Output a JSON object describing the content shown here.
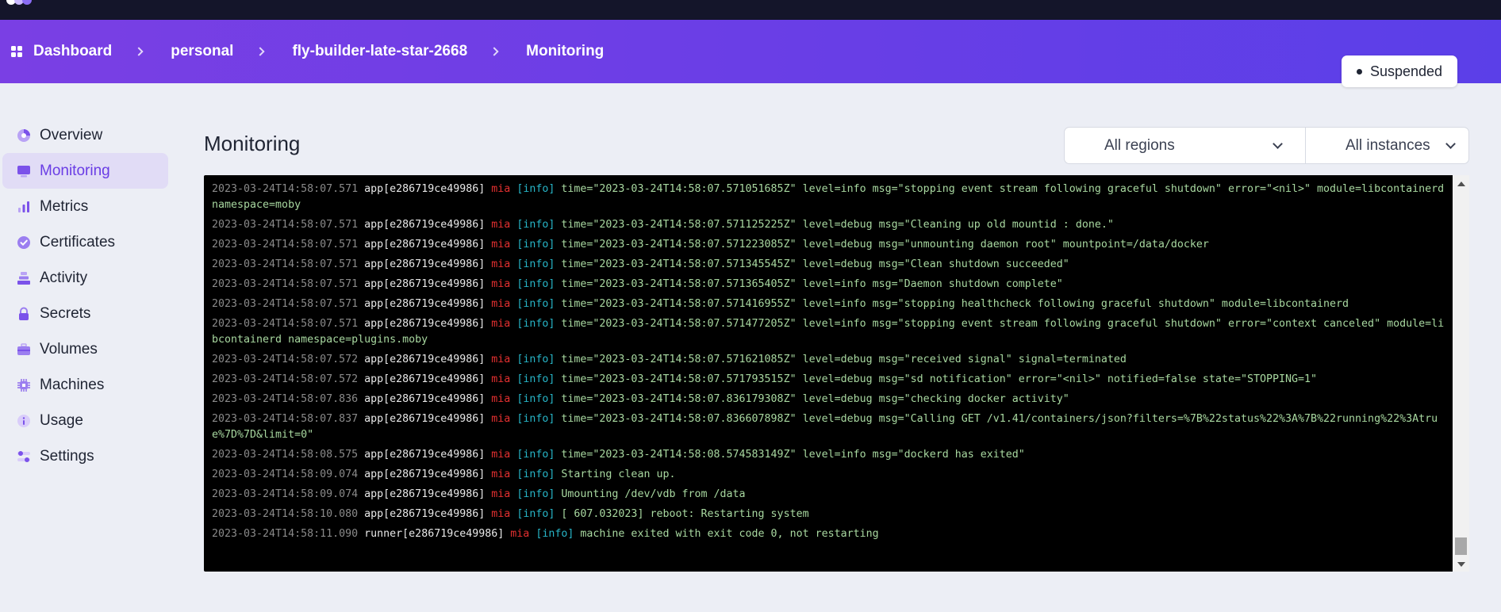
{
  "header": {
    "breadcrumbs": [
      "Dashboard",
      "personal",
      "fly-builder-late-star-2668",
      "Monitoring"
    ],
    "status_badge": "Suspended"
  },
  "sidebar": {
    "items": [
      {
        "label": "Overview",
        "icon": "gauge-icon"
      },
      {
        "label": "Monitoring",
        "icon": "monitor-icon",
        "active": true
      },
      {
        "label": "Metrics",
        "icon": "bar-chart-icon"
      },
      {
        "label": "Certificates",
        "icon": "badge-check-icon"
      },
      {
        "label": "Activity",
        "icon": "stack-icon"
      },
      {
        "label": "Secrets",
        "icon": "lock-icon"
      },
      {
        "label": "Volumes",
        "icon": "briefcase-icon"
      },
      {
        "label": "Machines",
        "icon": "chip-icon"
      },
      {
        "label": "Usage",
        "icon": "info-icon"
      },
      {
        "label": "Settings",
        "icon": "settings-icon"
      }
    ]
  },
  "main": {
    "title": "Monitoring",
    "region_filter": "All regions",
    "instance_filter": "All instances"
  },
  "colors": {
    "accent": "#6a3de5",
    "log_bg": "#000000",
    "region_red": "#e43030",
    "level_cyan": "#27b5c7",
    "message_green": "#a8d8a0"
  },
  "logs": [
    {
      "ts": "2023-03-24T14:58:07.571",
      "src": "app[e286719ce49986]",
      "region": "mia",
      "level": "[info]",
      "msg": "time=\"2023-03-24T14:58:07.571051685Z\" level=info msg=\"stopping event stream following graceful shutdown\" error=\"<nil>\" module=libcontainerd namespace=moby"
    },
    {
      "ts": "2023-03-24T14:58:07.571",
      "src": "app[e286719ce49986]",
      "region": "mia",
      "level": "[info]",
      "msg": "time=\"2023-03-24T14:58:07.571125225Z\" level=debug msg=\"Cleaning up old mountid : done.\""
    },
    {
      "ts": "2023-03-24T14:58:07.571",
      "src": "app[e286719ce49986]",
      "region": "mia",
      "level": "[info]",
      "msg": "time=\"2023-03-24T14:58:07.571223085Z\" level=debug msg=\"unmounting daemon root\" mountpoint=/data/docker"
    },
    {
      "ts": "2023-03-24T14:58:07.571",
      "src": "app[e286719ce49986]",
      "region": "mia",
      "level": "[info]",
      "msg": "time=\"2023-03-24T14:58:07.571345545Z\" level=debug msg=\"Clean shutdown succeeded\""
    },
    {
      "ts": "2023-03-24T14:58:07.571",
      "src": "app[e286719ce49986]",
      "region": "mia",
      "level": "[info]",
      "msg": "time=\"2023-03-24T14:58:07.571365405Z\" level=info msg=\"Daemon shutdown complete\""
    },
    {
      "ts": "2023-03-24T14:58:07.571",
      "src": "app[e286719ce49986]",
      "region": "mia",
      "level": "[info]",
      "msg": "time=\"2023-03-24T14:58:07.571416955Z\" level=info msg=\"stopping healthcheck following graceful shutdown\" module=libcontainerd"
    },
    {
      "ts": "2023-03-24T14:58:07.571",
      "src": "app[e286719ce49986]",
      "region": "mia",
      "level": "[info]",
      "msg": "time=\"2023-03-24T14:58:07.571477205Z\" level=info msg=\"stopping event stream following graceful shutdown\" error=\"context canceled\" module=libcontainerd namespace=plugins.moby"
    },
    {
      "ts": "2023-03-24T14:58:07.572",
      "src": "app[e286719ce49986]",
      "region": "mia",
      "level": "[info]",
      "msg": "time=\"2023-03-24T14:58:07.571621085Z\" level=debug msg=\"received signal\" signal=terminated"
    },
    {
      "ts": "2023-03-24T14:58:07.572",
      "src": "app[e286719ce49986]",
      "region": "mia",
      "level": "[info]",
      "msg": "time=\"2023-03-24T14:58:07.571793515Z\" level=debug msg=\"sd notification\" error=\"<nil>\" notified=false state=\"STOPPING=1\""
    },
    {
      "ts": "2023-03-24T14:58:07.836",
      "src": "app[e286719ce49986]",
      "region": "mia",
      "level": "[info]",
      "msg": "time=\"2023-03-24T14:58:07.836179308Z\" level=debug msg=\"checking docker activity\""
    },
    {
      "ts": "2023-03-24T14:58:07.837",
      "src": "app[e286719ce49986]",
      "region": "mia",
      "level": "[info]",
      "msg": "time=\"2023-03-24T14:58:07.836607898Z\" level=debug msg=\"Calling GET /v1.41/containers/json?filters=%7B%22status%22%3A%7B%22running%22%3Atrue%7D%7D&limit=0\""
    },
    {
      "ts": "2023-03-24T14:58:08.575",
      "src": "app[e286719ce49986]",
      "region": "mia",
      "level": "[info]",
      "msg": "time=\"2023-03-24T14:58:08.574583149Z\" level=info msg=\"dockerd has exited\""
    },
    {
      "ts": "2023-03-24T14:58:09.074",
      "src": "app[e286719ce49986]",
      "region": "mia",
      "level": "[info]",
      "msg": "Starting clean up."
    },
    {
      "ts": "2023-03-24T14:58:09.074",
      "src": "app[e286719ce49986]",
      "region": "mia",
      "level": "[info]",
      "msg": "Umounting /dev/vdb from /data"
    },
    {
      "ts": "2023-03-24T14:58:10.080",
      "src": "app[e286719ce49986]",
      "region": "mia",
      "level": "[info]",
      "msg": "[ 607.032023] reboot: Restarting system"
    },
    {
      "ts": "2023-03-24T14:58:11.090",
      "src": "runner[e286719ce49986]",
      "region": "mia",
      "level": "[info]",
      "msg": "machine exited with exit code 0, not restarting"
    }
  ]
}
